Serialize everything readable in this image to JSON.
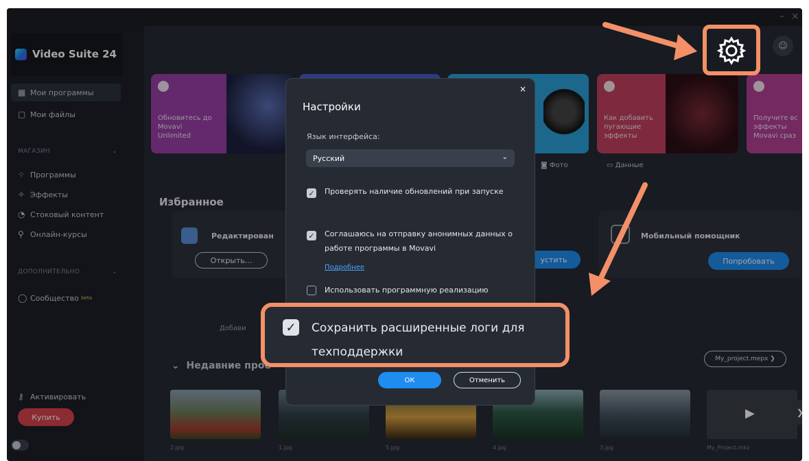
{
  "app": {
    "title": "Video Suite 24"
  },
  "window_controls": {
    "minimize": "–",
    "close": "×"
  },
  "sidebar": {
    "items": [
      {
        "label": "Мои программы",
        "icon": "grid-icon"
      },
      {
        "label": "Мои файлы",
        "icon": "file-icon"
      }
    ],
    "section_store": "МАГАЗИН",
    "store_items": [
      {
        "label": "Программы",
        "icon": "apps-icon"
      },
      {
        "label": "Эффекты",
        "icon": "sparkle-icon"
      },
      {
        "label": "Стоковый контент",
        "icon": "pie-icon"
      },
      {
        "label": "Онлайн-курсы",
        "icon": "pin-icon"
      }
    ],
    "section_extra": "ДОПОЛНИТЕЛЬНО",
    "community": "Сообщество",
    "beta": "beta",
    "activate": "Активировать",
    "buy": "Купить"
  },
  "banners": [
    {
      "text": "Обновитесь до\nMovavi\nUnlimited",
      "color": "#9a3fa6"
    },
    {
      "text": "",
      "color": "#4b59c8"
    },
    {
      "text": "",
      "color": "#2aa0d8"
    },
    {
      "text": "Как добавить\nпугающие\nэффекты",
      "color": "#c2405e"
    },
    {
      "text": "Получите вс\nэффекты\nMovavi сраз",
      "color": "#b24095"
    }
  ],
  "filters": {
    "photo": "Фото",
    "data": "Данные"
  },
  "favorites": {
    "title": "Избранное",
    "edit_label": "Редактирован",
    "open_btn": "Открыть...",
    "launch_btn": "устить",
    "mobile_label": "Мобильный помощник",
    "try_btn": "Попробовать",
    "add_label": "Добави"
  },
  "recent": {
    "title": "Недавние прое",
    "project_btn": "My_project.mepx",
    "files": [
      "2.jpg",
      "1.jpg",
      "5.jpg",
      "4.jpg",
      "3.jpg",
      "My_Project.mkv"
    ]
  },
  "dialog": {
    "title": "Настройки",
    "lang_label": "Язык интерфейса:",
    "lang_value": "Русский",
    "opt1": "Проверять наличие обновлений при запуске",
    "opt2": "Соглашаюсь на отправку анонимных данных о работе программы в Movavi",
    "more_link": "Подробнее",
    "opt3": "Использовать программную реализацию",
    "ok": "ОК",
    "cancel": "Отменить",
    "close": "×"
  },
  "callout": {
    "text": "Сохранить расширенные логи для техподдержки"
  },
  "accent": "#f39068"
}
